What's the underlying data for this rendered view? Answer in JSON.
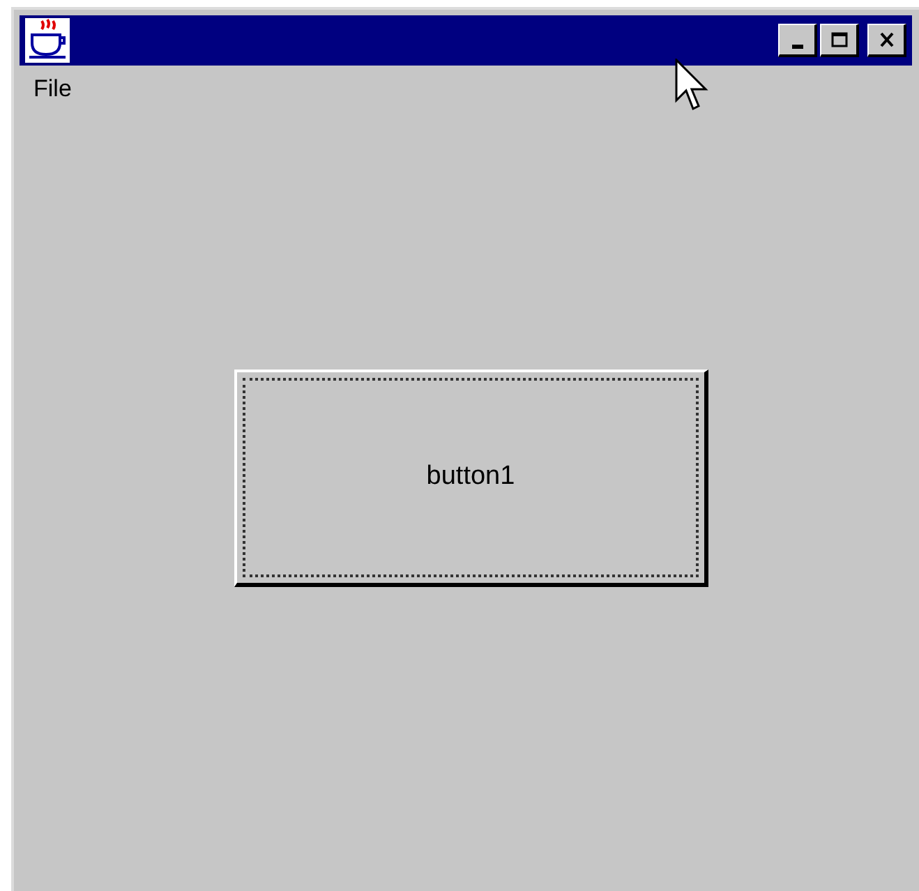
{
  "title_buttons": [
    {
      "kind": "minimize"
    },
    {
      "kind": "maximize"
    },
    {
      "kind": "close"
    }
  ],
  "menu": [
    {
      "label": "File"
    }
  ],
  "button": {
    "label": "button1",
    "focused": true
  }
}
